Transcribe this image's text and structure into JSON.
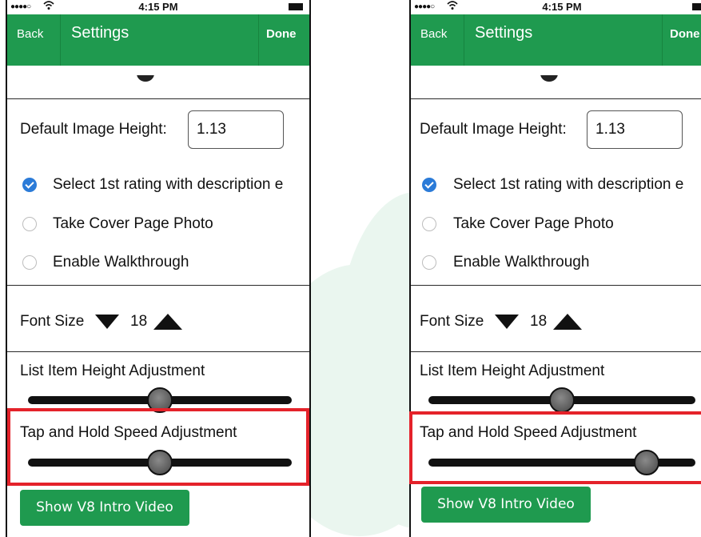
{
  "status_bar": {
    "signal": "●●●●○",
    "wifi": " ",
    "time": "4:15 PM"
  },
  "nav": {
    "back_label": "Back",
    "title": "Settings",
    "done_label": "Done"
  },
  "settings": {
    "default_image_height_label": "Default Image Height:",
    "default_image_height_value": "1.13",
    "options": [
      {
        "label": "Select 1st rating with description e",
        "checked": true
      },
      {
        "label": "Take Cover Page Photo",
        "checked": false
      },
      {
        "label": "Enable Walkthrough",
        "checked": false
      }
    ],
    "font_size_label": "Font Size",
    "font_size_value": "18",
    "list_item_height_label": "List Item Height Adjustment",
    "tap_hold_speed_label": "Tap and Hold Speed Adjustment",
    "intro_video_label": "Show V8 Intro Video"
  },
  "screens": [
    {
      "list_item_height_level": 0.5,
      "tap_hold_speed_level": 0.5
    },
    {
      "list_item_height_level": 0.5,
      "tap_hold_speed_level": 0.85
    }
  ],
  "colors": {
    "accent_green": "#1f9a4f",
    "highlight_red": "#e4222a",
    "check_blue": "#2b7bd8"
  },
  "icons": {
    "font_decrease": "triangle-down-icon",
    "font_increase": "triangle-up-icon"
  }
}
